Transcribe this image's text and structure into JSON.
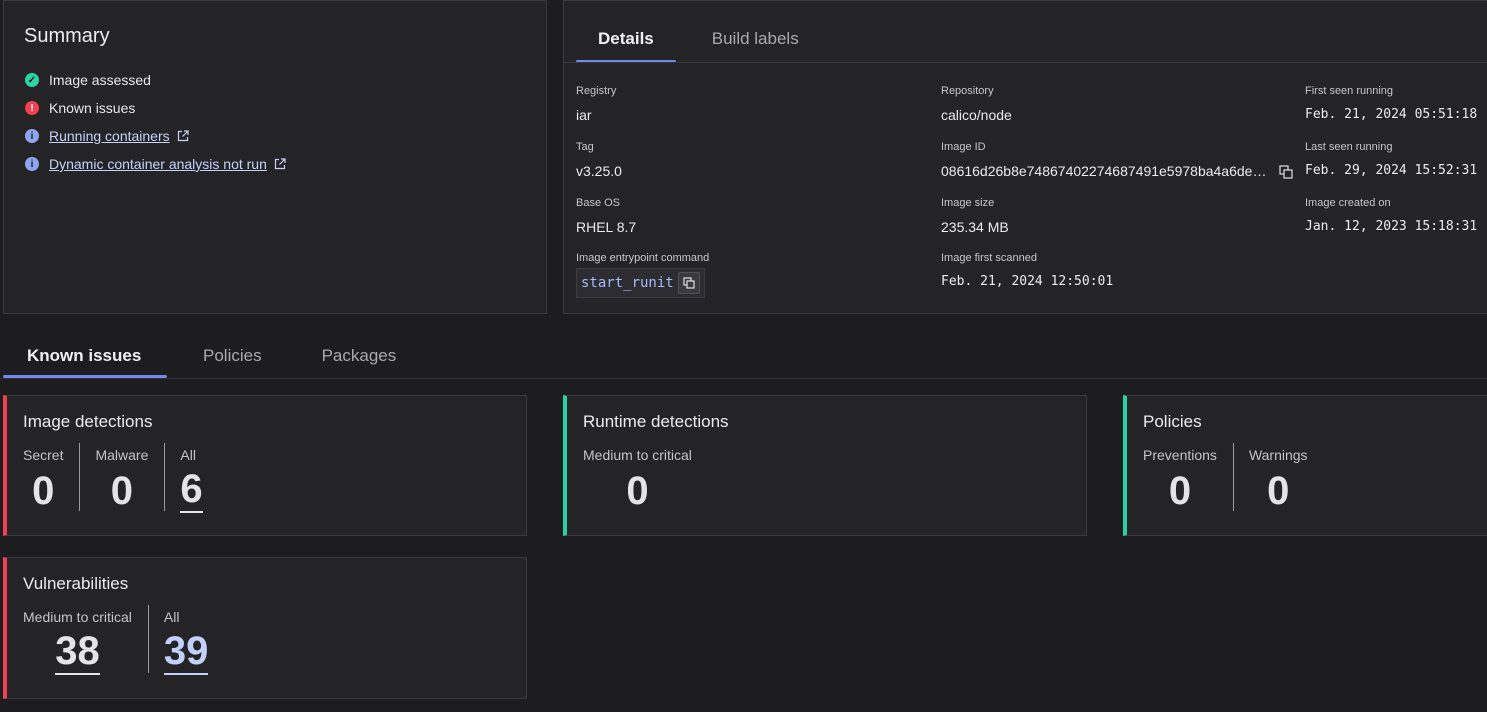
{
  "summary": {
    "title": "Summary",
    "items": [
      {
        "label": "Image assessed",
        "status": "ok",
        "icon": "check-circle-icon"
      },
      {
        "label": "Known issues",
        "status": "error",
        "icon": "exclamation-circle-icon"
      },
      {
        "label": "Running containers",
        "status": "info",
        "icon": "info-circle-icon",
        "link": true
      },
      {
        "label": "Dynamic container analysis not run",
        "status": "info",
        "icon": "info-circle-icon",
        "link": true
      }
    ]
  },
  "details": {
    "tabs": [
      "Details",
      "Build labels"
    ],
    "active_tab": "Details",
    "fields": {
      "registry": {
        "label": "Registry",
        "value": "iar"
      },
      "tag": {
        "label": "Tag",
        "value": "v3.25.0"
      },
      "base_os": {
        "label": "Base OS",
        "value": "RHEL 8.7"
      },
      "entrypoint": {
        "label": "Image entrypoint command",
        "value": "start_runit"
      },
      "repository": {
        "label": "Repository",
        "value": "calico/node"
      },
      "image_id": {
        "label": "Image ID",
        "value": "08616d26b8e74867402274687491e5978ba4a6de…"
      },
      "image_size": {
        "label": "Image size",
        "value": "235.34 MB"
      },
      "first_scanned": {
        "label": "Image first scanned",
        "value": "Feb. 21, 2024 12:50:01"
      },
      "first_seen": {
        "label": "First seen running",
        "value": "Feb. 21, 2024 05:51:18"
      },
      "last_seen": {
        "label": "Last seen running",
        "value": "Feb. 29, 2024 15:52:31"
      },
      "created_on": {
        "label": "Image created on",
        "value": "Jan. 12, 2023 15:18:31"
      }
    }
  },
  "known_issues_tabs": [
    "Known issues",
    "Policies",
    "Packages"
  ],
  "known_issues_active": "Known issues",
  "cards": {
    "image_detections": {
      "title": "Image detections",
      "metrics": [
        {
          "label": "Secret",
          "value": "0"
        },
        {
          "label": "Malware",
          "value": "0"
        },
        {
          "label": "All",
          "value": "6"
        }
      ]
    },
    "runtime_detections": {
      "title": "Runtime detections",
      "metrics": [
        {
          "label": "Medium to critical",
          "value": "0"
        }
      ]
    },
    "policies": {
      "title": "Policies",
      "metrics": [
        {
          "label": "Preventions",
          "value": "0"
        },
        {
          "label": "Warnings",
          "value": "0"
        }
      ]
    },
    "vulnerabilities": {
      "title": "Vulnerabilities",
      "metrics": [
        {
          "label": "Medium to critical",
          "value": "38"
        },
        {
          "label": "All",
          "value": "39"
        }
      ]
    }
  },
  "colors": {
    "critical": "#ee4152",
    "ok": "#27d3a6",
    "accent": "#6f8ae8",
    "link": "#c2d0fb"
  }
}
